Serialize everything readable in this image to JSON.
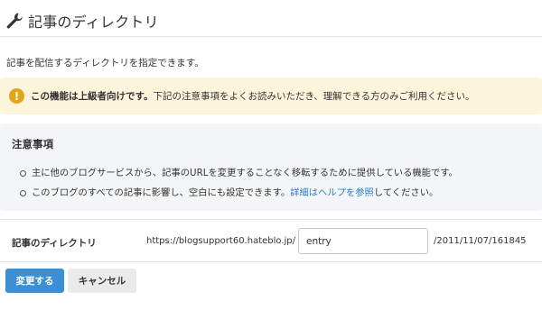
{
  "header": {
    "title": "記事のディレクトリ",
    "icon": "wrench-icon"
  },
  "intro": "記事を配信するディレクトリを指定できます。",
  "warning": {
    "icon": "exclamation-icon",
    "strong": "この機能は上級者向けです。",
    "text": "下記の注意事項をよくお読みいただき、理解できる方のみご利用ください。"
  },
  "notes": {
    "title": "注意事項",
    "item1": "主に他のブログサービスから、記事のURLを変更することなく移転するために提供している機能です。",
    "item2_prefix": "このブログのすべての記事に影響し、空白にも設定できます。",
    "item2_link": "詳細はヘルプを参照",
    "item2_suffix": "してください。"
  },
  "setting": {
    "label": "記事のディレクトリ",
    "url_prefix": "https://blogsupport60.hateblo.jp/",
    "directory_value": "entry",
    "url_suffix": "/2011/11/07/161845"
  },
  "buttons": {
    "submit": "変更する",
    "cancel": "キャンセル"
  },
  "colors": {
    "accent": "#3b8fd4",
    "link": "#2b7fc6",
    "warning_bg": "#fdf4dc",
    "warning_icon": "#e3a31a",
    "notes_bg": "#f4f5f6"
  }
}
